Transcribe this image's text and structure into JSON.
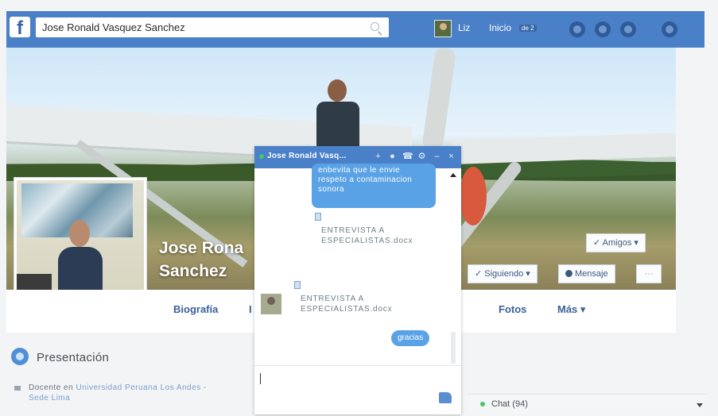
{
  "header": {
    "search_value": "Jose Ronald Vasquez Sanchez",
    "user_name": "Liz",
    "home_label": "Inicio",
    "home_badge": "de 2"
  },
  "profile": {
    "name_line1": "Jose Rona",
    "name_line2": "Sanchez"
  },
  "actions": {
    "friends_label": "✓ Amigos ▾",
    "following_label": "✓ Siguiendo ▾",
    "message_label": "Mensaje",
    "more_label": "···"
  },
  "tabs": [
    {
      "label": "Biografía"
    },
    {
      "label": "I"
    },
    {
      "label": "Fotos"
    },
    {
      "label": "Más ▾"
    }
  ],
  "intro": {
    "title": "Presentación",
    "education_prefix": "Docente en ",
    "education_link": "Universidad Peruana Los Andes - Sede Lima"
  },
  "chat": {
    "title": "Jose Ronald Vasq...",
    "bubble_text": "enbevita que le envie respeto a contaminacion sonora",
    "file1": "ENTREVISTA A ESPECIALISTAS.docx",
    "file2": "ENTREVISTA A ESPECIALISTAS.docx",
    "reply": "gracias"
  },
  "chatbar": {
    "label": "Chat (94)"
  },
  "colors": {
    "facebook_blue": "#4a80c7",
    "bubble_blue": "#5aa2e6",
    "online_green": "#44c767"
  }
}
